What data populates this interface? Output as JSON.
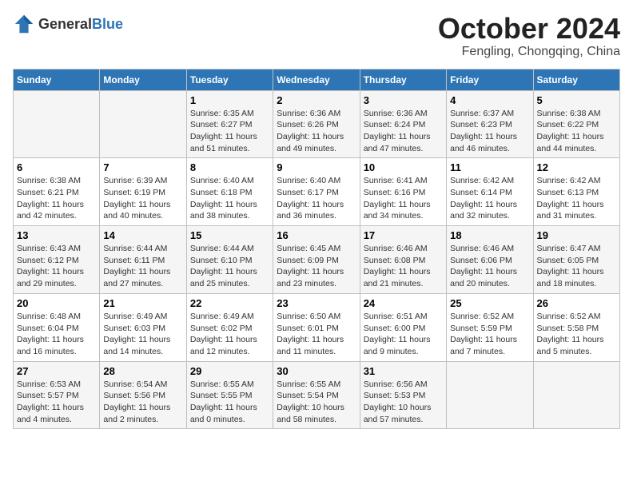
{
  "header": {
    "logo_general": "General",
    "logo_blue": "Blue",
    "month": "October 2024",
    "location": "Fengling, Chongqing, China"
  },
  "days_of_week": [
    "Sunday",
    "Monday",
    "Tuesday",
    "Wednesday",
    "Thursday",
    "Friday",
    "Saturday"
  ],
  "weeks": [
    [
      {
        "num": "",
        "sunrise": "",
        "sunset": "",
        "daylight": ""
      },
      {
        "num": "",
        "sunrise": "",
        "sunset": "",
        "daylight": ""
      },
      {
        "num": "1",
        "sunrise": "Sunrise: 6:35 AM",
        "sunset": "Sunset: 6:27 PM",
        "daylight": "Daylight: 11 hours and 51 minutes."
      },
      {
        "num": "2",
        "sunrise": "Sunrise: 6:36 AM",
        "sunset": "Sunset: 6:26 PM",
        "daylight": "Daylight: 11 hours and 49 minutes."
      },
      {
        "num": "3",
        "sunrise": "Sunrise: 6:36 AM",
        "sunset": "Sunset: 6:24 PM",
        "daylight": "Daylight: 11 hours and 47 minutes."
      },
      {
        "num": "4",
        "sunrise": "Sunrise: 6:37 AM",
        "sunset": "Sunset: 6:23 PM",
        "daylight": "Daylight: 11 hours and 46 minutes."
      },
      {
        "num": "5",
        "sunrise": "Sunrise: 6:38 AM",
        "sunset": "Sunset: 6:22 PM",
        "daylight": "Daylight: 11 hours and 44 minutes."
      }
    ],
    [
      {
        "num": "6",
        "sunrise": "Sunrise: 6:38 AM",
        "sunset": "Sunset: 6:21 PM",
        "daylight": "Daylight: 11 hours and 42 minutes."
      },
      {
        "num": "7",
        "sunrise": "Sunrise: 6:39 AM",
        "sunset": "Sunset: 6:19 PM",
        "daylight": "Daylight: 11 hours and 40 minutes."
      },
      {
        "num": "8",
        "sunrise": "Sunrise: 6:40 AM",
        "sunset": "Sunset: 6:18 PM",
        "daylight": "Daylight: 11 hours and 38 minutes."
      },
      {
        "num": "9",
        "sunrise": "Sunrise: 6:40 AM",
        "sunset": "Sunset: 6:17 PM",
        "daylight": "Daylight: 11 hours and 36 minutes."
      },
      {
        "num": "10",
        "sunrise": "Sunrise: 6:41 AM",
        "sunset": "Sunset: 6:16 PM",
        "daylight": "Daylight: 11 hours and 34 minutes."
      },
      {
        "num": "11",
        "sunrise": "Sunrise: 6:42 AM",
        "sunset": "Sunset: 6:14 PM",
        "daylight": "Daylight: 11 hours and 32 minutes."
      },
      {
        "num": "12",
        "sunrise": "Sunrise: 6:42 AM",
        "sunset": "Sunset: 6:13 PM",
        "daylight": "Daylight: 11 hours and 31 minutes."
      }
    ],
    [
      {
        "num": "13",
        "sunrise": "Sunrise: 6:43 AM",
        "sunset": "Sunset: 6:12 PM",
        "daylight": "Daylight: 11 hours and 29 minutes."
      },
      {
        "num": "14",
        "sunrise": "Sunrise: 6:44 AM",
        "sunset": "Sunset: 6:11 PM",
        "daylight": "Daylight: 11 hours and 27 minutes."
      },
      {
        "num": "15",
        "sunrise": "Sunrise: 6:44 AM",
        "sunset": "Sunset: 6:10 PM",
        "daylight": "Daylight: 11 hours and 25 minutes."
      },
      {
        "num": "16",
        "sunrise": "Sunrise: 6:45 AM",
        "sunset": "Sunset: 6:09 PM",
        "daylight": "Daylight: 11 hours and 23 minutes."
      },
      {
        "num": "17",
        "sunrise": "Sunrise: 6:46 AM",
        "sunset": "Sunset: 6:08 PM",
        "daylight": "Daylight: 11 hours and 21 minutes."
      },
      {
        "num": "18",
        "sunrise": "Sunrise: 6:46 AM",
        "sunset": "Sunset: 6:06 PM",
        "daylight": "Daylight: 11 hours and 20 minutes."
      },
      {
        "num": "19",
        "sunrise": "Sunrise: 6:47 AM",
        "sunset": "Sunset: 6:05 PM",
        "daylight": "Daylight: 11 hours and 18 minutes."
      }
    ],
    [
      {
        "num": "20",
        "sunrise": "Sunrise: 6:48 AM",
        "sunset": "Sunset: 6:04 PM",
        "daylight": "Daylight: 11 hours and 16 minutes."
      },
      {
        "num": "21",
        "sunrise": "Sunrise: 6:49 AM",
        "sunset": "Sunset: 6:03 PM",
        "daylight": "Daylight: 11 hours and 14 minutes."
      },
      {
        "num": "22",
        "sunrise": "Sunrise: 6:49 AM",
        "sunset": "Sunset: 6:02 PM",
        "daylight": "Daylight: 11 hours and 12 minutes."
      },
      {
        "num": "23",
        "sunrise": "Sunrise: 6:50 AM",
        "sunset": "Sunset: 6:01 PM",
        "daylight": "Daylight: 11 hours and 11 minutes."
      },
      {
        "num": "24",
        "sunrise": "Sunrise: 6:51 AM",
        "sunset": "Sunset: 6:00 PM",
        "daylight": "Daylight: 11 hours and 9 minutes."
      },
      {
        "num": "25",
        "sunrise": "Sunrise: 6:52 AM",
        "sunset": "Sunset: 5:59 PM",
        "daylight": "Daylight: 11 hours and 7 minutes."
      },
      {
        "num": "26",
        "sunrise": "Sunrise: 6:52 AM",
        "sunset": "Sunset: 5:58 PM",
        "daylight": "Daylight: 11 hours and 5 minutes."
      }
    ],
    [
      {
        "num": "27",
        "sunrise": "Sunrise: 6:53 AM",
        "sunset": "Sunset: 5:57 PM",
        "daylight": "Daylight: 11 hours and 4 minutes."
      },
      {
        "num": "28",
        "sunrise": "Sunrise: 6:54 AM",
        "sunset": "Sunset: 5:56 PM",
        "daylight": "Daylight: 11 hours and 2 minutes."
      },
      {
        "num": "29",
        "sunrise": "Sunrise: 6:55 AM",
        "sunset": "Sunset: 5:55 PM",
        "daylight": "Daylight: 11 hours and 0 minutes."
      },
      {
        "num": "30",
        "sunrise": "Sunrise: 6:55 AM",
        "sunset": "Sunset: 5:54 PM",
        "daylight": "Daylight: 10 hours and 58 minutes."
      },
      {
        "num": "31",
        "sunrise": "Sunrise: 6:56 AM",
        "sunset": "Sunset: 5:53 PM",
        "daylight": "Daylight: 10 hours and 57 minutes."
      },
      {
        "num": "",
        "sunrise": "",
        "sunset": "",
        "daylight": ""
      },
      {
        "num": "",
        "sunrise": "",
        "sunset": "",
        "daylight": ""
      }
    ]
  ]
}
